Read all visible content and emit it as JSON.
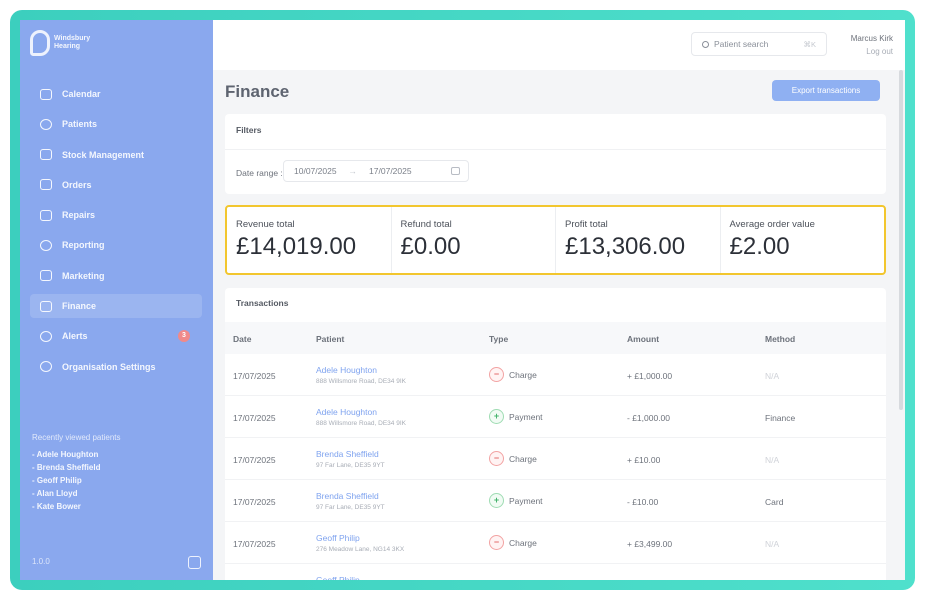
{
  "app": {
    "logo_text": "Windsbury Hearing",
    "version": "1.0.0"
  },
  "sidebar": {
    "items": [
      {
        "label": "Calendar",
        "icon": "calendar-icon"
      },
      {
        "label": "Patients",
        "icon": "smile-icon"
      },
      {
        "label": "Stock Management",
        "icon": "clipboard-icon"
      },
      {
        "label": "Orders",
        "icon": "orders-icon"
      },
      {
        "label": "Repairs",
        "icon": "wrench-icon"
      },
      {
        "label": "Reporting",
        "icon": "clock-icon"
      },
      {
        "label": "Marketing",
        "icon": "mail-icon"
      },
      {
        "label": "Finance",
        "icon": "card-icon",
        "active": true
      },
      {
        "label": "Alerts",
        "icon": "bell-icon",
        "badge": "3"
      },
      {
        "label": "Organisation Settings",
        "icon": "gear-icon"
      }
    ],
    "recent_title": "Recently viewed patients",
    "recent": [
      "- Adele Houghton",
      "- Brenda Sheffield",
      "- Geoff Philip",
      "- Alan Lloyd",
      "- Kate Bower"
    ]
  },
  "topbar": {
    "search_placeholder": "Patient search",
    "search_shortcut": "⌘K",
    "user_name": "Marcus Kirk",
    "logout": "Log out"
  },
  "page": {
    "title": "Finance",
    "export_label": "Export transactions"
  },
  "filters": {
    "title": "Filters",
    "date_label": "Date range :",
    "date_from": "10/07/2025",
    "date_sep": "→",
    "date_to": "17/07/2025"
  },
  "stats": [
    {
      "label": "Revenue total",
      "value": "£14,019.00"
    },
    {
      "label": "Refund total",
      "value": "£0.00"
    },
    {
      "label": "Profit total",
      "value": "£13,306.00"
    },
    {
      "label": "Average order value",
      "value": "£2.00"
    }
  ],
  "transactions": {
    "title": "Transactions",
    "columns": [
      "Date",
      "Patient",
      "Type",
      "Amount",
      "Method"
    ],
    "rows": [
      {
        "date": "17/07/2025",
        "name": "Adele Houghton",
        "address": "888 Willsmore Road, DE34 9IK",
        "type": "Charge",
        "amount": "+ £1,000.00",
        "method": "N/A"
      },
      {
        "date": "17/07/2025",
        "name": "Adele Houghton",
        "address": "888 Willsmore Road, DE34 9IK",
        "type": "Payment",
        "amount": "- £1,000.00",
        "method": "Finance"
      },
      {
        "date": "17/07/2025",
        "name": "Brenda Sheffield",
        "address": "97 Far Lane, DE35 9YT",
        "type": "Charge",
        "amount": "+ £10.00",
        "method": "N/A"
      },
      {
        "date": "17/07/2025",
        "name": "Brenda Sheffield",
        "address": "97 Far Lane, DE35 9YT",
        "type": "Payment",
        "amount": "- £10.00",
        "method": "Card"
      },
      {
        "date": "17/07/2025",
        "name": "Geoff Philip",
        "address": "276 Meadow Lane, NG14 3KX",
        "type": "Charge",
        "amount": "+ £3,499.00",
        "method": "N/A"
      },
      {
        "date": "",
        "name": "Geoff Philip",
        "address": "",
        "type": "",
        "amount": "",
        "method": ""
      }
    ]
  },
  "colors": {
    "sidebar": "#8aa8ee",
    "accent": "#8fb0f2",
    "highlight_border": "#f2c62e",
    "frame": "#3ccfbe"
  }
}
